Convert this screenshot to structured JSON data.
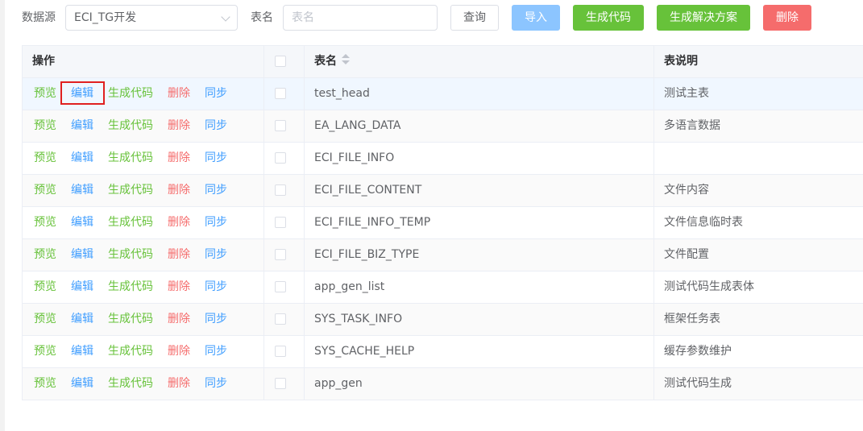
{
  "toolbar": {
    "datasource_label": "数据源",
    "datasource_value": "ECI_TG开发",
    "tablename_label": "表名",
    "tablename_placeholder": "表名",
    "query_label": "查询",
    "import_label": "导入",
    "gen_code_label": "生成代码",
    "gen_solution_label": "生成解决方案",
    "delete_label": "删除"
  },
  "table": {
    "headers": {
      "ops": "操作",
      "name": "表名",
      "desc": "表说明"
    },
    "ops": {
      "preview": "预览",
      "edit": "编辑",
      "gen": "生成代码",
      "del": "删除",
      "sync": "同步"
    },
    "rows": [
      {
        "name": "test_head",
        "desc": "测试主表"
      },
      {
        "name": "EA_LANG_DATA",
        "desc": "多语言数据"
      },
      {
        "name": "ECI_FILE_INFO",
        "desc": ""
      },
      {
        "name": "ECI_FILE_CONTENT",
        "desc": "文件内容"
      },
      {
        "name": "ECI_FILE_INFO_TEMP",
        "desc": "文件信息临时表"
      },
      {
        "name": "ECI_FILE_BIZ_TYPE",
        "desc": "文件配置"
      },
      {
        "name": "app_gen_list",
        "desc": "测试代码生成表体"
      },
      {
        "name": "SYS_TASK_INFO",
        "desc": "框架任务表"
      },
      {
        "name": "SYS_CACHE_HELP",
        "desc": "缓存参数维护"
      },
      {
        "name": "app_gen",
        "desc": "测试代码生成"
      }
    ]
  },
  "colors": {
    "primary": "#409eff",
    "success": "#67c23a",
    "danger": "#f56c6c",
    "highlight_box": "#e02020"
  }
}
